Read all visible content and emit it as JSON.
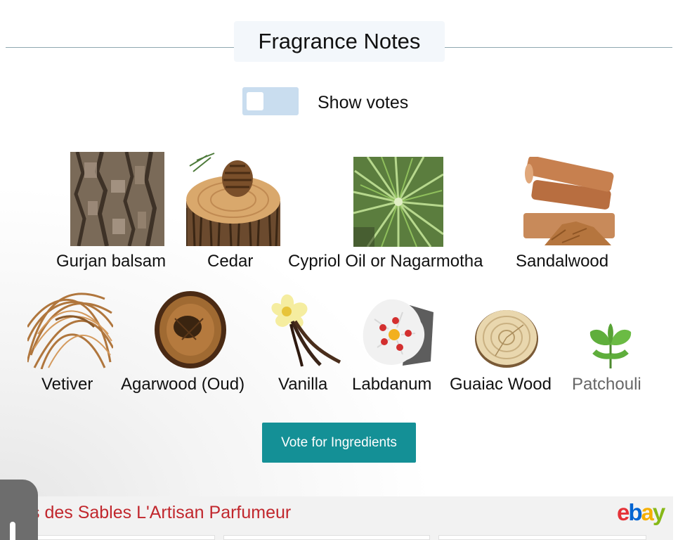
{
  "section": {
    "title": "Fragrance Notes"
  },
  "toggle": {
    "label": "Show votes",
    "on": false
  },
  "notes": [
    {
      "label": "Gurjan balsam",
      "icon": "tree-bark-icon"
    },
    {
      "label": "Cedar",
      "icon": "pine-cone-icon"
    },
    {
      "label": "Cypriol Oil or Nagarmotha",
      "icon": "grass-plant-icon"
    },
    {
      "label": "Sandalwood",
      "icon": "wood-sticks-icon"
    },
    {
      "label": "Vetiver",
      "icon": "vetiver-roots-icon"
    },
    {
      "label": "Agarwood (Oud)",
      "icon": "agarwood-slice-icon"
    },
    {
      "label": "Vanilla",
      "icon": "vanilla-flower-icon"
    },
    {
      "label": "Labdanum",
      "icon": "cistus-flower-icon"
    },
    {
      "label": "Guaiac Wood",
      "icon": "wood-slice-icon"
    },
    {
      "label": "Patchouli",
      "icon": "patchouli-leaf-icon"
    }
  ],
  "vote_button": {
    "label": "Vote for Ingredients"
  },
  "ebay": {
    "title": "s des Sables L'Artisan Parfumeur",
    "logo": {
      "e": "e",
      "b": "b",
      "a": "a",
      "y": "y"
    }
  },
  "colors": {
    "accent": "#149096",
    "toggle_bg": "#c9ddef",
    "ebay_title": "#c1272d"
  }
}
